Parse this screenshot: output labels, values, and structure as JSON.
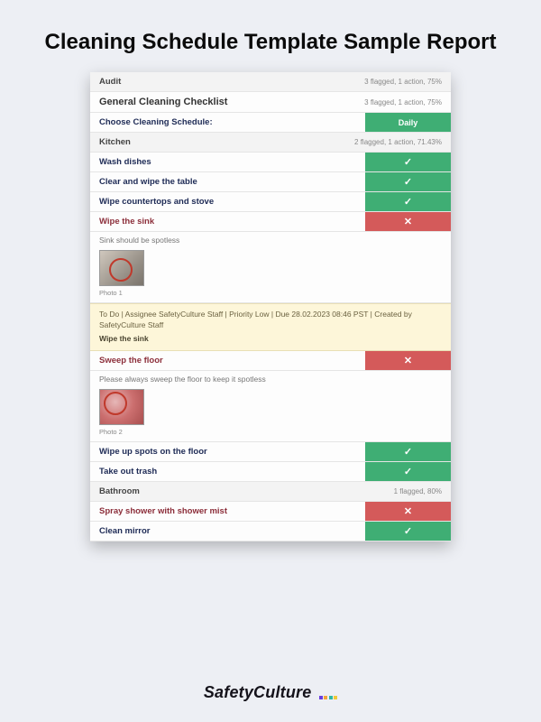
{
  "pageTitle": "Cleaning Schedule Template Sample Report",
  "audit": {
    "label": "Audit",
    "meta": "3 flagged, 1 action, 75%"
  },
  "checklist": {
    "label": "General Cleaning Checklist",
    "meta": "3 flagged, 1 action, 75%"
  },
  "schedule": {
    "label": "Choose Cleaning Schedule:",
    "value": "Daily"
  },
  "kitchen": {
    "label": "Kitchen",
    "meta": "2 flagged, 1 action, 71.43%",
    "items": [
      {
        "label": "Wash dishes",
        "pass": true
      },
      {
        "label": "Clear and wipe the table",
        "pass": true
      },
      {
        "label": "Wipe countertops and stove",
        "pass": true
      },
      {
        "label": "Wipe the sink",
        "pass": false
      }
    ],
    "sinkNote": "Sink should be spotless",
    "photo1": "Photo 1",
    "action": {
      "text": "To Do  |  Assignee SafetyCulture Staff  |  Priority Low  |  Due 28.02.2023 08:46 PST  |  Created by SafetyCulture Staff",
      "sub": "Wipe the sink"
    },
    "items2": [
      {
        "label": "Sweep the floor",
        "pass": false
      }
    ],
    "floorNote": "Please always sweep the floor to keep it spotless",
    "photo2": "Photo 2",
    "items3": [
      {
        "label": "Wipe up spots on the floor",
        "pass": true
      },
      {
        "label": "Take out trash",
        "pass": true
      }
    ]
  },
  "bathroom": {
    "label": "Bathroom",
    "meta": "1 flagged, 80%",
    "items": [
      {
        "label": "Spray shower with shower mist",
        "pass": false
      },
      {
        "label": "Clean mirror",
        "pass": true
      }
    ]
  },
  "brand": "SafetyCulture"
}
